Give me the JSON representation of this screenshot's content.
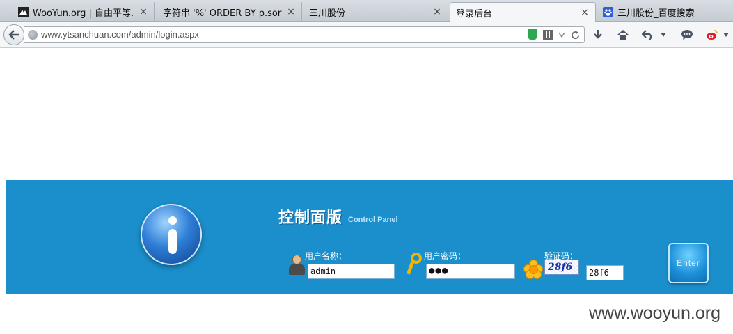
{
  "tabs": [
    {
      "label": "WooYun.org | 自由平等...",
      "icon": "wooyun-favicon-icon",
      "active": false
    },
    {
      "label": "字符串 '%' ORDER BY p.sort ...",
      "icon": "",
      "active": false
    },
    {
      "label": "三川股份",
      "icon": "",
      "active": false
    },
    {
      "label": "登录后台",
      "icon": "",
      "active": true
    },
    {
      "label": "三川股份_百度搜索",
      "icon": "baidu-paw-icon",
      "active": false
    }
  ],
  "close_glyph": "×",
  "nav": {
    "url": "www.ytsanchuan.com/admin/login.aspx"
  },
  "panel": {
    "title_cn": "控制面版",
    "title_en": "Control Panel",
    "username_label": "用户名称：",
    "username_value": "admin",
    "password_label": "用户密码：",
    "password_value": "●●●",
    "captcha_label": "验证码：",
    "captcha_image_text": "28f6",
    "captcha_input_value": "28f6",
    "enter_label": "Enter"
  },
  "watermark": "www.wooyun.org",
  "colors": {
    "panel_bg": "#1b8fcc"
  }
}
